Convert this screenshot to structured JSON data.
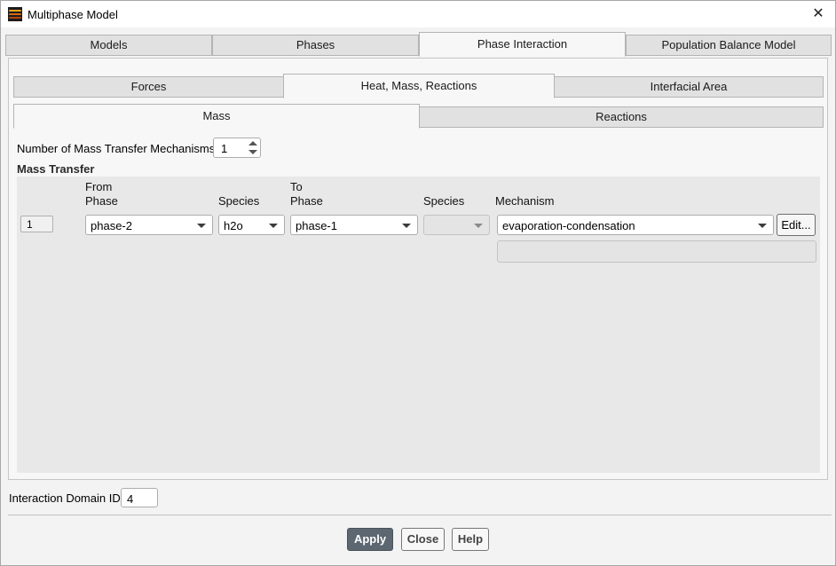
{
  "window": {
    "title": "Multiphase Model",
    "close_glyph": "✕",
    "app_icon": "ansys-fluent-icon",
    "close_icon": "close-icon"
  },
  "top_tabs": [
    {
      "label": "Models",
      "active": false
    },
    {
      "label": "Phases",
      "active": false
    },
    {
      "label": "Phase Interaction",
      "active": true
    },
    {
      "label": "Population Balance Model",
      "active": false
    }
  ],
  "sub_tabs": [
    {
      "label": "Forces",
      "active": false
    },
    {
      "label": "Heat, Mass, Reactions",
      "active": true
    },
    {
      "label": "Interfacial Area",
      "active": false
    }
  ],
  "inner_tabs": [
    {
      "label": "Mass",
      "active": true
    },
    {
      "label": "Reactions",
      "active": false
    }
  ],
  "mass": {
    "num_label": "Number of Mass Transfer Mechanisms",
    "num_value": "1",
    "section_title": "Mass Transfer",
    "headers": {
      "from": "From",
      "from_phase": "Phase",
      "from_species": "Species",
      "to": "To",
      "to_phase": "Phase",
      "to_species": "Species",
      "mechanism": "Mechanism"
    },
    "rows": [
      {
        "index": "1",
        "from_phase": "phase-2",
        "from_species": "h2o",
        "to_phase": "phase-1",
        "to_species": "",
        "mechanism": "evaporation-condensation",
        "edit_label": "Edit..."
      }
    ]
  },
  "domain": {
    "label": "Interaction Domain ID",
    "value": "4"
  },
  "buttons": {
    "apply": "Apply",
    "close": "Close",
    "help": "Help"
  },
  "colors": {
    "primary_button": "#5d6771",
    "window_bg": "#f3f3f3",
    "active_tab": "#f7f7f7",
    "inactive_tab": "#e1e1e1"
  }
}
